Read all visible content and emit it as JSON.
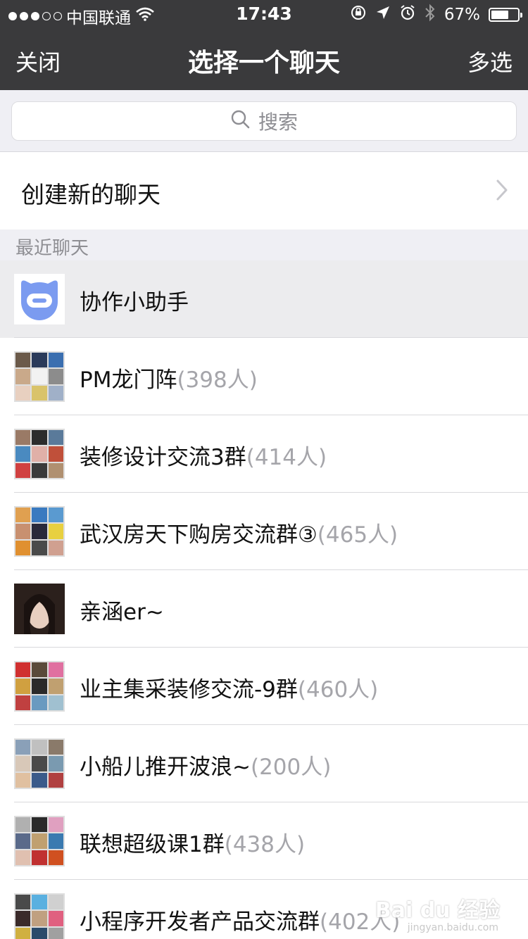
{
  "status_bar": {
    "carrier": "中国联通",
    "time": "17:43",
    "battery": "67%",
    "battery_level": 0.67,
    "signal_filled": 3,
    "signal_total": 5,
    "icons": [
      "wifi-icon",
      "orientation-lock-icon",
      "location-arrow-icon",
      "alarm-icon",
      "bluetooth-icon"
    ]
  },
  "navbar": {
    "left": "关闭",
    "title": "选择一个聊天",
    "right": "多选"
  },
  "search": {
    "placeholder": "搜索"
  },
  "create": {
    "label": "创建新的聊天"
  },
  "section": {
    "label": "最近聊天"
  },
  "chats": [
    {
      "name": "协作小助手",
      "count": ""
    },
    {
      "name": "PM龙门阵",
      "count": "(398人)"
    },
    {
      "name": "装修设计交流3群",
      "count": "(414人)"
    },
    {
      "name": "武汉房天下购房交流群③",
      "count": "(465人)"
    },
    {
      "name": "亲涵er~",
      "count": ""
    },
    {
      "name": "业主集采装修交流-9群",
      "count": "(460人)"
    },
    {
      "name": "小船儿推开波浪~",
      "count": "(200人)"
    },
    {
      "name": "联想超级课1群",
      "count": "(438人)"
    },
    {
      "name": "小程序开发者产品交流群",
      "count": "(402人)"
    }
  ],
  "colors": {
    "nav_bg": "#3a3a3c",
    "page_bg": "#efeff4",
    "assistant_icon": "#7b9bf0",
    "count_gray": "#a5a5aa"
  },
  "watermark": {
    "brand": "Bai du 经验",
    "url": "jingyan.baidu.com"
  }
}
